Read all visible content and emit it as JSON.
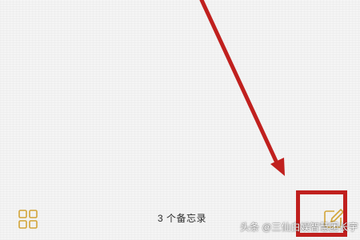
{
  "toolbar": {
    "gallery_icon": "grid-four-squares-icon",
    "notes_count": "3 个备忘录",
    "compose_icon": "pencil-square-icon"
  },
  "annotation": {
    "arrow_color": "#c0201e",
    "box_color": "#c0201e"
  },
  "watermark": {
    "text": "头条 @三仙白娱智慧团长宇"
  },
  "colors": {
    "background": "#f4f4f4",
    "icon_gold": "#d2a437",
    "text": "#2a2a2a"
  }
}
